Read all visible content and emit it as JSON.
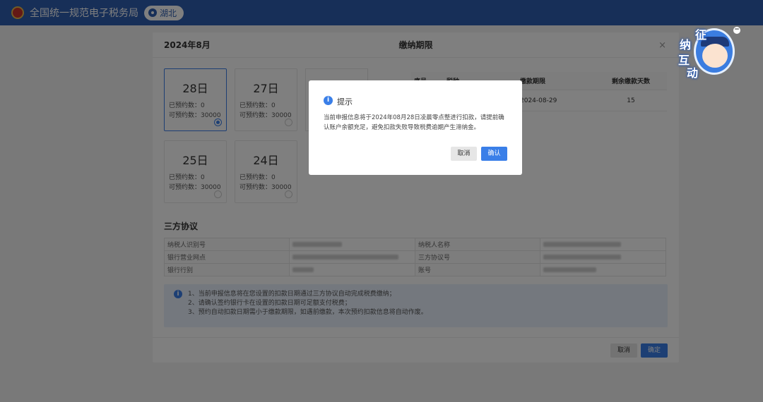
{
  "topbar": {
    "site_title": "全国统一规范电子税务局",
    "region": "湖北"
  },
  "dialog": {
    "month": "2024年8月",
    "title": "缴纳期限",
    "close_icon": "close-icon",
    "cards": [
      {
        "day": "28日",
        "booked": "已预约数：0",
        "available": "可预约数：30000",
        "selected": true
      },
      {
        "day": "27日",
        "booked": "已预约数：0",
        "available": "可预约数：30000",
        "selected": false
      },
      {
        "day": "25日",
        "booked": "已预约数：0",
        "available": "可预约数：30000",
        "selected": false
      },
      {
        "day": "24日",
        "booked": "已预约数：0",
        "available": "可预约数：30000",
        "selected": false
      }
    ],
    "table": {
      "headers": [
        "序号",
        "税种",
        "缴款期限",
        "剩余缴款天数"
      ],
      "rows": [
        {
          "index": "",
          "tax_type": "",
          "deadline": "2024-08-29",
          "days_left": "15"
        }
      ]
    },
    "section_title": "三方协议",
    "protocol": {
      "taxpayer_id_label": "纳税人识别号",
      "taxpayer_name_label": "纳税人名称",
      "bank_branch_label": "银行营业网点",
      "agreement_no_label": "三方协议号",
      "bank_label": "银行行别",
      "account_label": "账号"
    },
    "notice": {
      "line1": "1、当前申报信息将在您设置的扣款日期通过三方协议自动完成税费缴纳；",
      "line2": "2、请确认签约银行卡在设置的扣款日期可足额支付税费；",
      "line3": "3、预约自动扣款日期需小于缴款期限，如遇前缴款，本次预约扣款信息将自动作废。"
    },
    "footer": {
      "cancel": "取消",
      "confirm": "确定"
    }
  },
  "prompt": {
    "title": "提示",
    "message": "当前申报信息将于2024年08月28日凌晨零点整进行扣款，请提前确认账户余额充足，避免扣款失败导致税费逾期产生滞纳金。",
    "cancel": "取消",
    "confirm": "确认"
  },
  "mascot": {
    "chars": [
      "征",
      "纳",
      "互",
      "动"
    ],
    "minimize": "−"
  },
  "colors": {
    "topbar": "#2f5fb0",
    "accent": "#3a7fe8",
    "notice_bg": "#e8f0fc"
  }
}
